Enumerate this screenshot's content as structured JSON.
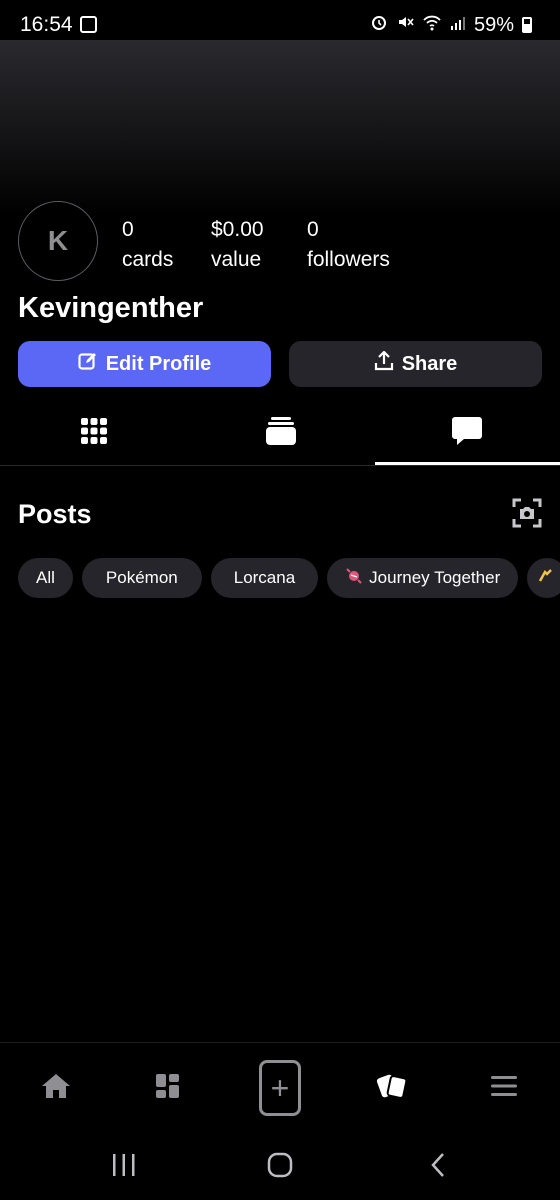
{
  "status_bar": {
    "time": "16:54",
    "battery": "59%"
  },
  "profile": {
    "avatar_letter": "K",
    "username": "Kevingenther",
    "stats": [
      {
        "value": "0",
        "label": "cards"
      },
      {
        "value": "$0.00",
        "label": "value"
      },
      {
        "value": "0",
        "label": "followers"
      }
    ]
  },
  "actions": {
    "edit_label": "Edit Profile",
    "share_label": "Share"
  },
  "tabs": {
    "active": "posts",
    "items": [
      "grid-icon",
      "collection-stack-icon",
      "chat-bubble-icon"
    ]
  },
  "posts": {
    "title": "Posts",
    "filters": [
      "All",
      "Pokémon",
      "Lorcana",
      "Journey Together"
    ]
  },
  "bottom_nav": [
    "home-icon",
    "dashboard-icon",
    "add-button",
    "cards-icon",
    "menu-icon"
  ],
  "colors": {
    "accent": "#5b67f5",
    "chip_bg": "#26252b",
    "background": "#000000"
  }
}
